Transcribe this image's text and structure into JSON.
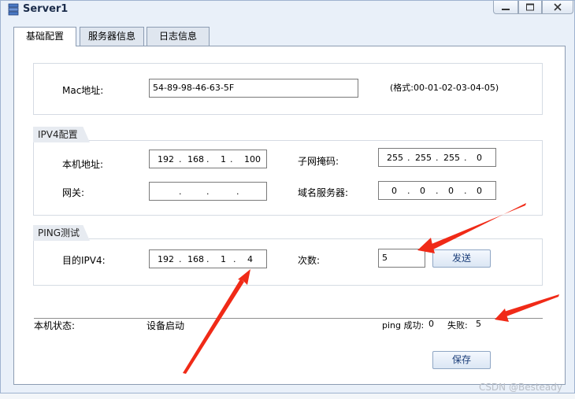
{
  "window": {
    "title": "Server1",
    "controls": [
      "minimize-icon",
      "maximize-icon",
      "close-icon"
    ]
  },
  "tabs": [
    {
      "label": "基础配置",
      "active": true
    },
    {
      "label": "服务器信息",
      "active": false
    },
    {
      "label": "日志信息",
      "active": false
    }
  ],
  "mac": {
    "label": "Mac地址:",
    "value": "54-89-98-46-63-5F",
    "hint": "(格式:00-01-02-03-04-05)"
  },
  "ipv4": {
    "section_title": "IPV4配置",
    "local_ip_label": "本机地址:",
    "local_ip": [
      "192",
      "168",
      "1",
      "100"
    ],
    "subnet_label": "子网掩码:",
    "subnet": [
      "255",
      "255",
      "255",
      "0"
    ],
    "gateway_label": "网关:",
    "gateway": [
      "",
      "",
      "",
      ""
    ],
    "dns_label": "域名服务器:",
    "dns": [
      "0",
      "0",
      "0",
      "0"
    ]
  },
  "ping": {
    "section_title": "PING测试",
    "target_label": "目的IPV4:",
    "target": [
      "192",
      "168",
      "1",
      "4"
    ],
    "count_label": "次数:",
    "count": "5",
    "send_label": "发送"
  },
  "status": {
    "label": "本机状态:",
    "value": "设备启动",
    "ping_success_label": "ping 成功:",
    "ping_success": "0",
    "fail_label": "失败:",
    "fail": "5"
  },
  "save_label": "保存",
  "watermark": "CSDN @Besteady",
  "colors": {
    "arrow": "#f02a17",
    "button_text": "#1a3d78",
    "window_bg": "#e9f0f9"
  }
}
